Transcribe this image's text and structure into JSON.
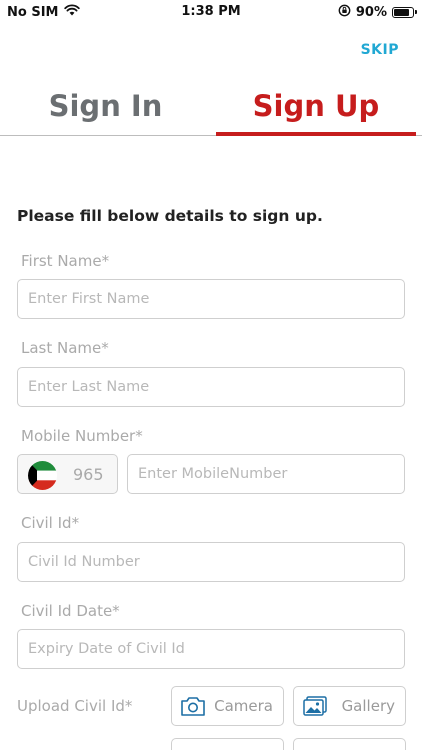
{
  "status_bar": {
    "carrier": "No SIM",
    "time": "1:38 PM",
    "battery": "90%",
    "battery_level": 0.9
  },
  "header": {
    "skip_label": "SKIP"
  },
  "tabs": [
    {
      "label": "Sign In",
      "active": false
    },
    {
      "label": "Sign Up",
      "active": true
    }
  ],
  "form": {
    "instruction": "Please fill below details to sign up.",
    "first_name": {
      "label": "First Name*",
      "placeholder": "Enter First Name",
      "value": ""
    },
    "last_name": {
      "label": "Last Name*",
      "placeholder": "Enter Last Name",
      "value": ""
    },
    "mobile": {
      "label": "Mobile Number*",
      "country_code": "965",
      "placeholder": "Enter MobileNumber",
      "value": ""
    },
    "civil_id": {
      "label": "Civil Id*",
      "placeholder": "Civil Id Number",
      "value": ""
    },
    "civil_id_date": {
      "label": "Civil Id Date*",
      "placeholder": "Expiry Date of Civil Id",
      "value": ""
    },
    "upload_civil_id": {
      "label": "Upload Civil Id*",
      "camera_label": "Camera",
      "gallery_label": "Gallery"
    }
  },
  "colors": {
    "accent_red": "#c61d1d",
    "link_blue": "#21a8d3",
    "inactive_gray": "#6b6f72"
  },
  "icons": {
    "wifi": "wifi-icon",
    "orientation_lock": "orientation-lock-icon",
    "battery": "battery-icon",
    "camera": "camera-icon",
    "gallery": "gallery-icon",
    "flag": "kuwait-flag-icon"
  }
}
